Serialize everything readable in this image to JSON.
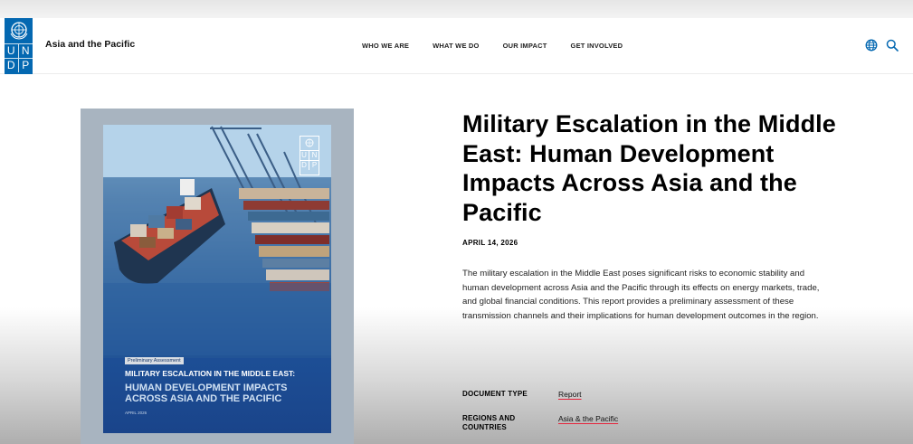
{
  "header": {
    "logo_letters": [
      "U",
      "N",
      "D",
      "P"
    ],
    "site_name": "Asia and the Pacific",
    "nav": [
      {
        "label": "WHO WE ARE"
      },
      {
        "label": "WHAT WE DO"
      },
      {
        "label": "OUR IMPACT"
      },
      {
        "label": "GET INVOLVED"
      }
    ],
    "icons": [
      "globe-icon",
      "search-icon"
    ]
  },
  "cover": {
    "badge": "Preliminary Assessment",
    "title_line1": "MILITARY ESCALATION IN THE MIDDLE EAST:",
    "title_line2": "HUMAN DEVELOPMENT IMPACTS ACROSS ASIA AND THE PACIFIC",
    "date": "APRIL 2026"
  },
  "article": {
    "title": "Military Escalation in the Middle East: Human Development Impacts Across Asia and the Pacific",
    "date": "APRIL 14, 2026",
    "description": "The military escalation in the Middle East poses significant risks to economic stability and human development across Asia and the Pacific through its effects on energy markets, trade, and global financial conditions. This report provides a preliminary assessment of these transmission channels and their implications for human development outcomes in the region."
  },
  "meta": [
    {
      "label": "DOCUMENT TYPE",
      "value": "Report"
    },
    {
      "label": "REGIONS AND COUNTRIES",
      "value": "Asia & the Pacific"
    }
  ],
  "colors": {
    "brand": "#0468b1",
    "link_underline": "#e5243b",
    "cover_blue": "#1a448a"
  }
}
